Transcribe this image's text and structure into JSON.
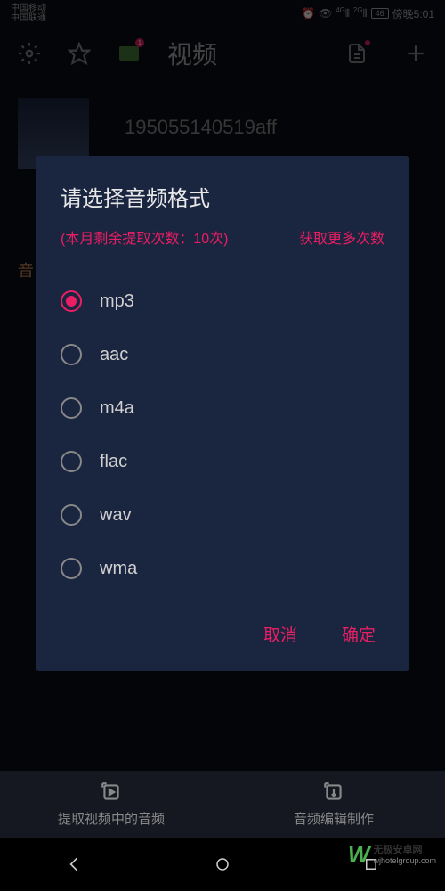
{
  "statusBar": {
    "carrier1": "中国移动",
    "carrier2": "中国联通",
    "signal4g": "4G",
    "signal2g": "2G",
    "battery": "46",
    "time": "傍晚5:01"
  },
  "toolbar": {
    "title": "视频",
    "folderBadge": "1"
  },
  "content": {
    "fileName": "195055140519aff",
    "tabLabel": "音"
  },
  "dialog": {
    "title": "请选择音频格式",
    "remainLabel": "(本月剩余提取次数：10次)",
    "getMore": "获取更多次数",
    "options": [
      {
        "label": "mp3",
        "selected": true
      },
      {
        "label": "aac",
        "selected": false
      },
      {
        "label": "m4a",
        "selected": false
      },
      {
        "label": "flac",
        "selected": false
      },
      {
        "label": "wav",
        "selected": false
      },
      {
        "label": "wma",
        "selected": false
      }
    ],
    "cancel": "取消",
    "confirm": "确定"
  },
  "bottomTabs": {
    "tab1": "提取视频中的音频",
    "tab2": "音频编辑制作"
  },
  "watermark": {
    "logo": "W",
    "main": "无极安卓网",
    "sub": "wjhotelgroup.com"
  }
}
